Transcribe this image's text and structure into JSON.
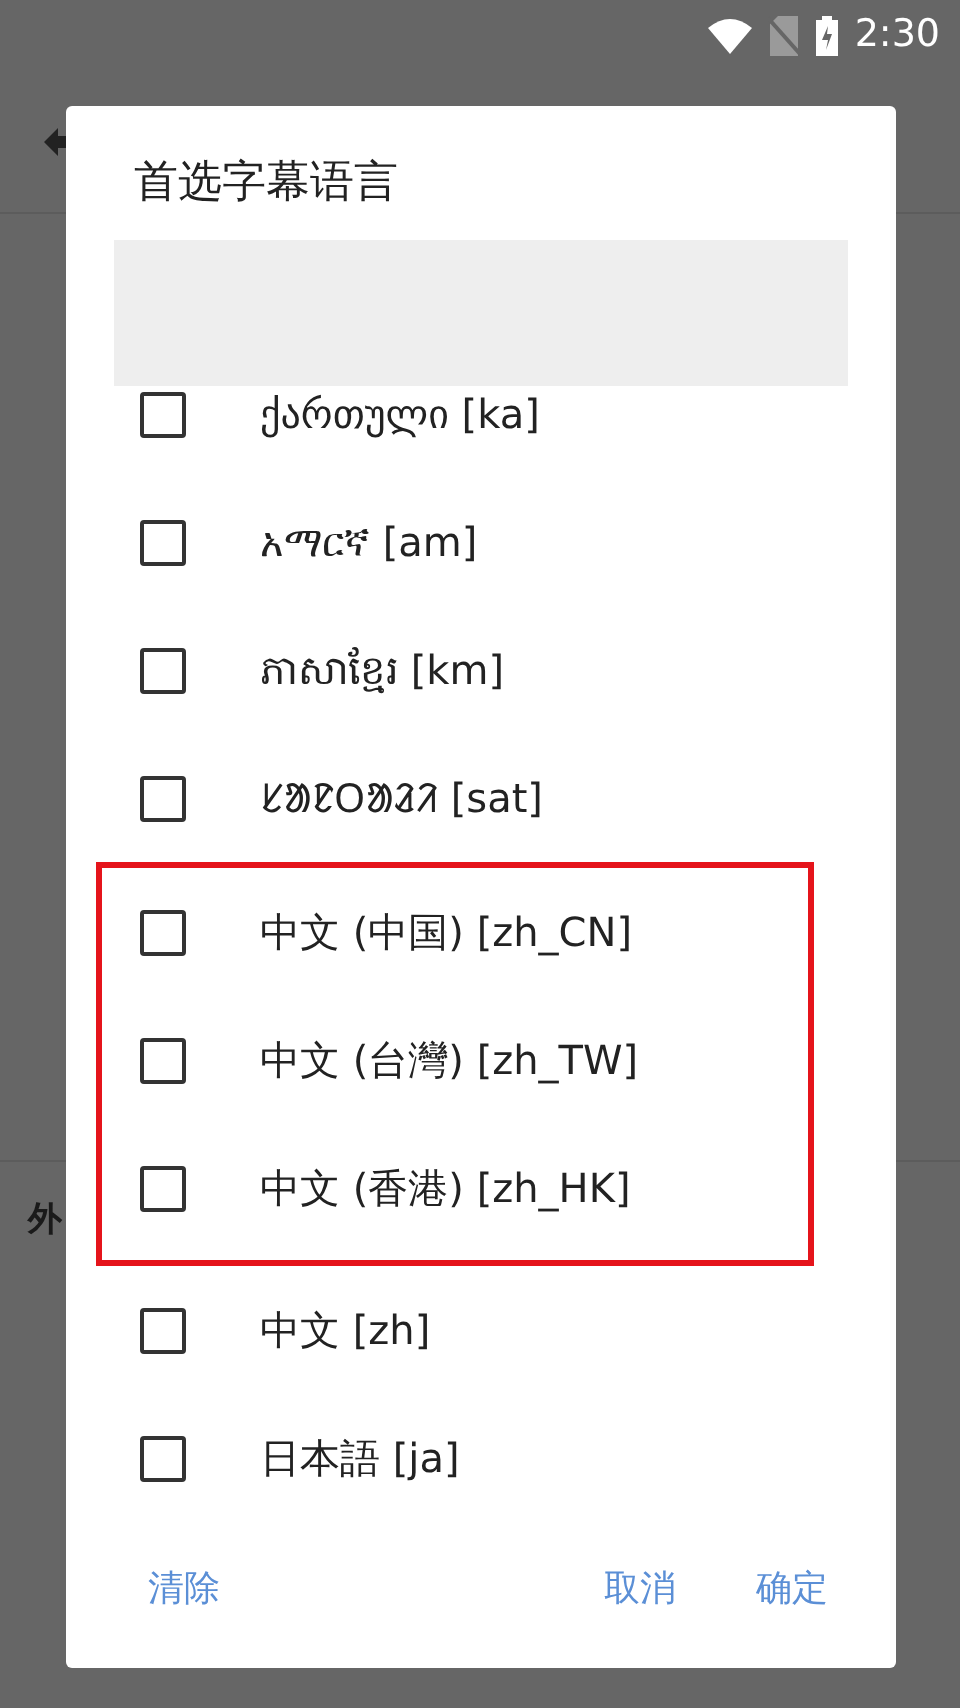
{
  "status_bar": {
    "time": "2:30"
  },
  "background": {
    "section_header": "外"
  },
  "dialog": {
    "title": "首选字幕语言",
    "languages": [
      {
        "label": "ქართული [ka]",
        "checked": false,
        "highlighted": false
      },
      {
        "label": "አማርኛ [am]",
        "checked": false,
        "highlighted": false
      },
      {
        "label": "ភាសាខ្មែរ [km]",
        "checked": false,
        "highlighted": false
      },
      {
        "label": "ᱥᱟᱱᱛᱟᱲᱤ [sat]",
        "checked": false,
        "highlighted": false
      },
      {
        "label": "中文 (中国) [zh_CN]",
        "checked": false,
        "highlighted": true
      },
      {
        "label": "中文 (台灣) [zh_TW]",
        "checked": false,
        "highlighted": true
      },
      {
        "label": "中文 (香港) [zh_HK]",
        "checked": false,
        "highlighted": true
      },
      {
        "label": "中文 [zh]",
        "checked": false,
        "highlighted": false
      },
      {
        "label": "日本語 [ja]",
        "checked": false,
        "highlighted": false
      }
    ],
    "buttons": {
      "left": [
        "清除"
      ],
      "right": [
        "取消",
        "确定"
      ]
    }
  }
}
